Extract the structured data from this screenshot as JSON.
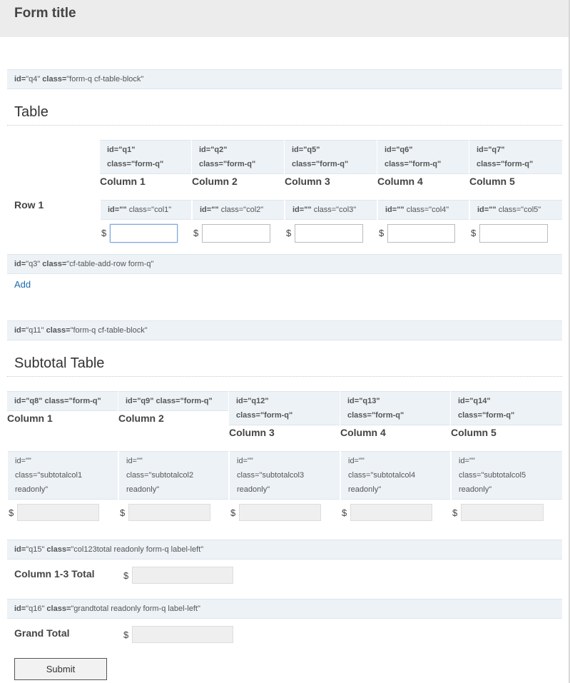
{
  "form": {
    "title": "Form title",
    "submit_label": "Submit"
  },
  "table": {
    "block": {
      "id_key": "id=",
      "id_val": "\"q4\"",
      "class_key": " class=",
      "class_val": "\"form-q cf-table-block\""
    },
    "title": "Table",
    "row_label": "Row 1",
    "columns": [
      {
        "head_id": "id=\"q1\"",
        "head_class": "class=\"form-q\"",
        "label": "Column 1",
        "input_id": "id=\"\"",
        "input_class": " class=\"col1\"",
        "currency": "$",
        "value": ""
      },
      {
        "head_id": "id=\"q2\"",
        "head_class": "class=\"form-q\"",
        "label": "Column 2",
        "input_id": "id=\"\"",
        "input_class": " class=\"col2\"",
        "currency": "$",
        "value": ""
      },
      {
        "head_id": "id=\"q5\"",
        "head_class": "class=\"form-q\"",
        "label": "Column 3",
        "input_id": "id=\"\"",
        "input_class": " class=\"col3\"",
        "currency": "$",
        "value": ""
      },
      {
        "head_id": "id=\"q6\"",
        "head_class": "class=\"form-q\"",
        "label": "Column 4",
        "input_id": "id=\"\"",
        "input_class": " class=\"col4\"",
        "currency": "$",
        "value": ""
      },
      {
        "head_id": "id=\"q7\"",
        "head_class": "class=\"form-q\"",
        "label": "Column 5",
        "input_id": "id=\"\"",
        "input_class": " class=\"col5\"",
        "currency": "$",
        "value": ""
      }
    ],
    "add_row": {
      "id_key": "id=",
      "id_val": "\"q3\"",
      "class_key": " class=",
      "class_val": "\"cf-table-add-row form-q\"",
      "link": "Add"
    }
  },
  "subtotal": {
    "block": {
      "id_key": "id=",
      "id_val": "\"q11\"",
      "class_key": " class=",
      "class_val": "\"form-q cf-table-block\""
    },
    "title": "Subtotal Table",
    "columns": [
      {
        "head": "id=\"q8\" class=\"form-q\"",
        "label": "Column 1",
        "in_id": "id=\"\"",
        "in_class": "class=\"subtotalcol1",
        "in_ro": "readonly\"",
        "currency": "$",
        "value": ""
      },
      {
        "head": "id=\"q9\" class=\"form-q\"",
        "label": "Column 2",
        "in_id": "id=\"\"",
        "in_class": "class=\"subtotalcol2",
        "in_ro": "readonly\"",
        "currency": "$",
        "value": ""
      },
      {
        "head_id": "id=\"q12\"",
        "head_class": "class=\"form-q\"",
        "label": "Column 3",
        "in_id": "id=\"\"",
        "in_class": "class=\"subtotalcol3",
        "in_ro": "readonly\"",
        "currency": "$",
        "value": ""
      },
      {
        "head_id": "id=\"q13\"",
        "head_class": "class=\"form-q\"",
        "label": "Column 4",
        "in_id": "id=\"\"",
        "in_class": "class=\"subtotalcol4",
        "in_ro": "readonly\"",
        "currency": "$",
        "value": ""
      },
      {
        "head_id": "id=\"q14\"",
        "head_class": "class=\"form-q\"",
        "label": "Column 5",
        "in_id": "id=\"\"",
        "in_class": "class=\"subtotalcol5",
        "in_ro": "readonly\"",
        "currency": "$",
        "value": ""
      }
    ]
  },
  "col123": {
    "id_key": "id=",
    "id_val": "\"q15\"",
    "class_key": " class=",
    "class_val": "\"col123total readonly form-q label-left\"",
    "label": "Column 1-3 Total",
    "currency": "$",
    "value": ""
  },
  "grand": {
    "id_key": "id=",
    "id_val": "\"q16\"",
    "class_key": " class=",
    "class_val": "\"grandtotal readonly form-q label-left\"",
    "label": "Grand Total",
    "currency": "$",
    "value": ""
  }
}
